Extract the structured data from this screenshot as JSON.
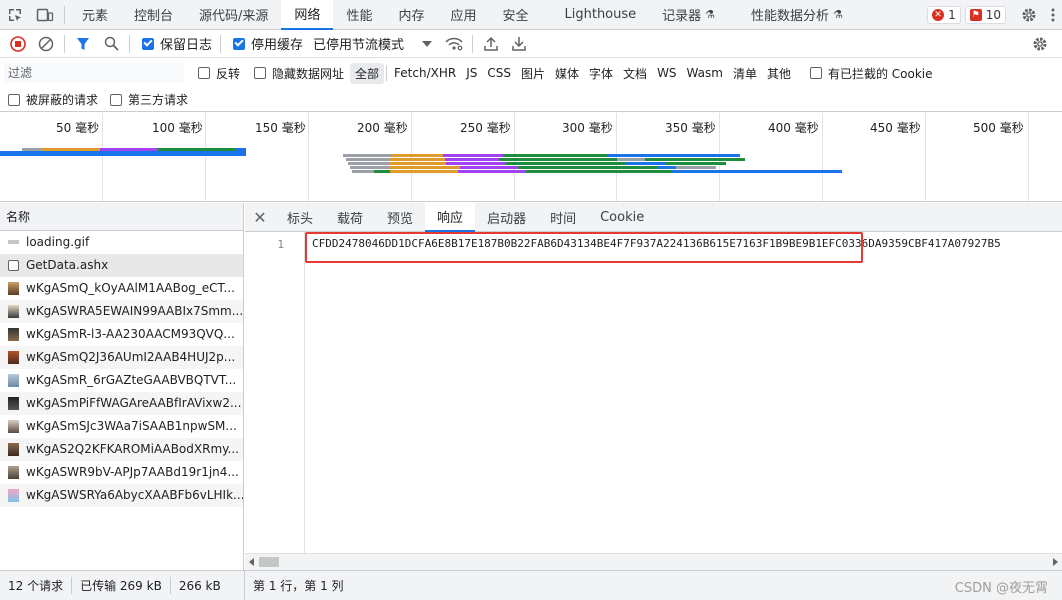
{
  "topbar": {
    "tabs": [
      "元素",
      "控制台",
      "源代码/来源",
      "网络",
      "性能",
      "内存",
      "应用",
      "安全",
      "Lighthouse",
      "记录器",
      "性能数据分析"
    ],
    "active_tab": "网络",
    "error_count": "1",
    "warning_count": "10"
  },
  "toolbar": {
    "preserve_log": "保留日志",
    "disable_cache": "停用缓存",
    "throttle": "已停用节流模式"
  },
  "filter": {
    "placeholder": "过滤",
    "invert": "反转",
    "hide_data_urls": "隐藏数据网址",
    "types": [
      "全部",
      "Fetch/XHR",
      "JS",
      "CSS",
      "图片",
      "媒体",
      "字体",
      "文档",
      "WS",
      "Wasm",
      "清单",
      "其他"
    ],
    "blocked_cookies": "有已拦截的 Cookie",
    "blocked_requests": "被屏蔽的请求",
    "third_party": "第三方请求"
  },
  "overview": {
    "ticks": [
      "50 毫秒",
      "100 毫秒",
      "150 毫秒",
      "200 毫秒",
      "250 毫秒",
      "300 毫秒",
      "350 毫秒",
      "400 毫秒",
      "450 毫秒",
      "500 毫秒"
    ]
  },
  "request_list": {
    "header": "名称",
    "items": [
      "loading.gif",
      "GetData.ashx",
      "wKgASmQ_kOyAAlM1AABog_eCT...",
      "wKgASWRA5EWAIN99AABIx7Smm...",
      "wKgASmR-l3-AA230AACM93QVQ...",
      "wKgASmQ2J36AUmI2AAB4HUJ2p...",
      "wKgASmR_6rGAZteGAABVBQTVT...",
      "wKgASmPiFfWAGAreAABfIrAVixw2...",
      "wKgASmSJc3WAa7iSAAB1npwSM...",
      "wKgAS2Q2KFKAROMiAABodXRmy...",
      "wKgASWR9bV-APJp7AABd19r1jn4...",
      "wKgASWSRYa6AbycXAABFb6vLHIk..."
    ],
    "selected": "GetData.ashx"
  },
  "detail": {
    "tabs": [
      "标头",
      "载荷",
      "预览",
      "响应",
      "启动器",
      "时间",
      "Cookie"
    ],
    "active_tab": "响应",
    "line_number": "1",
    "response_text": "CFDD2478046DD1DCFA6E8B17E187B0B22FAB6D43134BE4F7F937A224136B615E7163F1B9BE9B1EFC0336DA9359CBF417A07927B5"
  },
  "status": {
    "requests": "12 个请求",
    "transferred": "已传输 269 kB",
    "resources": "266 kB",
    "cursor": "第 1 行，第 1 列",
    "watermark": "CSDN @夜无霄"
  },
  "colors": {
    "accent": "#1a73e8",
    "error": "#d93025",
    "highlight_box": "#e53935"
  }
}
